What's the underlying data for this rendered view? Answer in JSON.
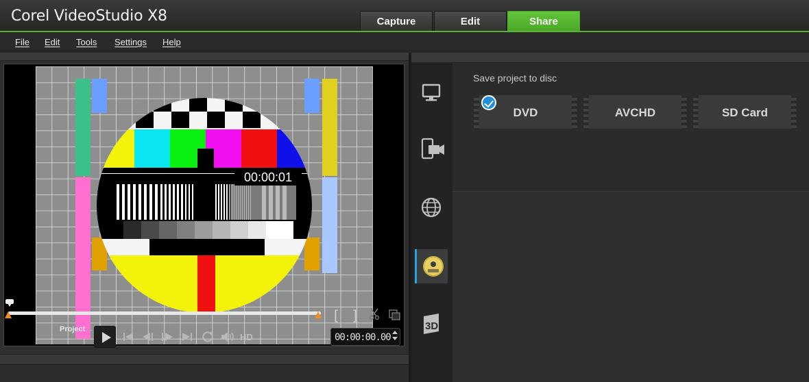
{
  "app": {
    "title": "Corel VideoStudio X8"
  },
  "tabs": [
    {
      "label": "Capture",
      "active": false
    },
    {
      "label": "Edit",
      "active": false
    },
    {
      "label": "Share",
      "active": true
    }
  ],
  "menu": [
    "File",
    "Edit",
    "Tools",
    "Settings",
    "Help"
  ],
  "preview": {
    "overlay_timecode": "00:00:01",
    "mode_label": "Project",
    "quality_label": "HD",
    "timecode": "00:00:00.00",
    "controls": [
      "play-icon",
      "go-to-start-icon",
      "previous-frame-icon",
      "next-frame-icon",
      "go-to-end-icon",
      "repeat-icon",
      "volume-icon"
    ],
    "trim_markers": [
      "[",
      "]"
    ]
  },
  "share": {
    "side_nav": [
      "computer-icon",
      "device-icon",
      "web-icon",
      "disc-icon",
      "3d-icon"
    ],
    "active_nav": "disc-icon",
    "section_label": "Save project to disc",
    "options": [
      {
        "label": "DVD",
        "selected": true
      },
      {
        "label": "AVCHD",
        "selected": false
      },
      {
        "label": "SD Card",
        "selected": false
      }
    ]
  },
  "colors": {
    "accent_green": "#57b52e",
    "accent_blue": "#2aa3e6",
    "trim_orange": "#f28a1c"
  }
}
